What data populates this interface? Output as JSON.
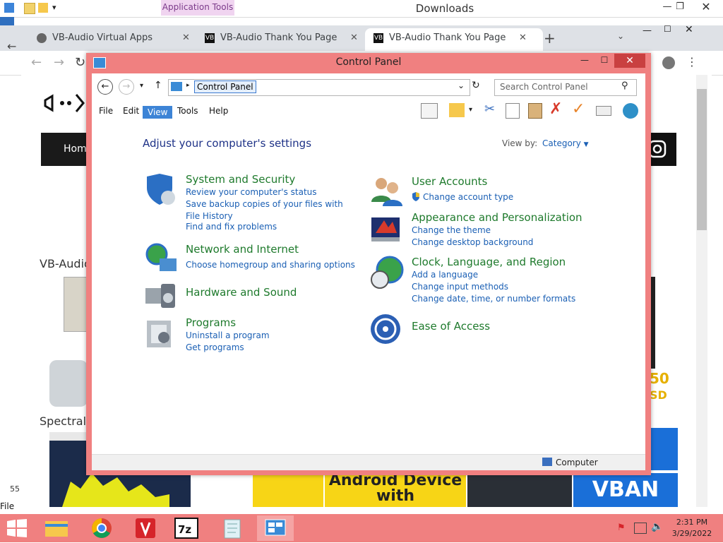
{
  "explorer": {
    "app_tools": "Application Tools",
    "title": "Downloads"
  },
  "chrome": {
    "tabs": [
      {
        "label": "VB-Audio Virtual Apps"
      },
      {
        "label": "VB-Audio Thank You Page"
      },
      {
        "label": "VB-Audio Thank You Page"
      }
    ],
    "new_tab": "+"
  },
  "page": {
    "nav_home": "Home",
    "section1": "VB-Audio",
    "section2": "Spectralis",
    "side_num": "55",
    "android": "Android Device with",
    "vban": "VBAN",
    "promo1": "50",
    "promo2": "SD"
  },
  "control_panel": {
    "title": "Control Panel",
    "address": "Control Panel",
    "search_placeholder": "Search Control Panel",
    "menu": [
      "File",
      "Edit",
      "View",
      "Tools",
      "Help"
    ],
    "heading": "Adjust your computer's settings",
    "view_by_label": "View by:",
    "view_by_value": "Category",
    "left_categories": [
      {
        "title": "System and Security",
        "links": [
          "Review your computer's status",
          "Save backup copies of your files with File History",
          "Find and fix problems"
        ]
      },
      {
        "title": "Network and Internet",
        "links": [
          "Choose homegroup and sharing options"
        ]
      },
      {
        "title": "Hardware and Sound",
        "links": []
      },
      {
        "title": "Programs",
        "links": [
          "Uninstall a program",
          "Get programs"
        ]
      }
    ],
    "right_categories": [
      {
        "title": "User Accounts",
        "links": [
          "Change account type"
        ]
      },
      {
        "title": "Appearance and Personalization",
        "links": [
          "Change the theme",
          "Change desktop background"
        ]
      },
      {
        "title": "Clock, Language, and Region",
        "links": [
          "Add a language",
          "Change input methods",
          "Change date, time, or number formats"
        ]
      },
      {
        "title": "Ease of Access",
        "links": []
      }
    ],
    "status": "Computer"
  },
  "taskbar": {
    "time": "2:31 PM",
    "date": "3/29/2022"
  },
  "file_label": "File"
}
